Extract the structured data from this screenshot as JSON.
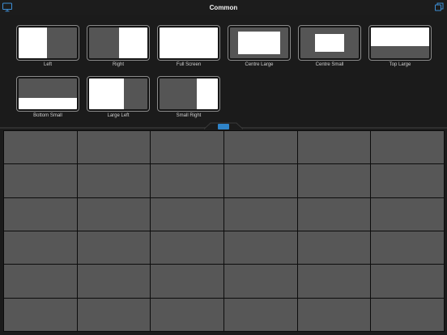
{
  "header": {
    "title": "Common",
    "left_icon": "monitor-icon",
    "right_icon": "window-stack-icon"
  },
  "presets": [
    {
      "label": "Left"
    },
    {
      "label": "Right"
    },
    {
      "label": "Full Screen"
    },
    {
      "label": "Centre Large"
    },
    {
      "label": "Centre Small"
    },
    {
      "label": "Top Large"
    },
    {
      "label": "Bottom Small"
    },
    {
      "label": "Large Left"
    },
    {
      "label": "Small Right"
    }
  ],
  "grid": {
    "rows": 6,
    "columns": 6
  },
  "colors": {
    "background": "#1b1b1b",
    "cell": "#575757",
    "accent": "#2f84c9",
    "window": "#ffffff"
  }
}
